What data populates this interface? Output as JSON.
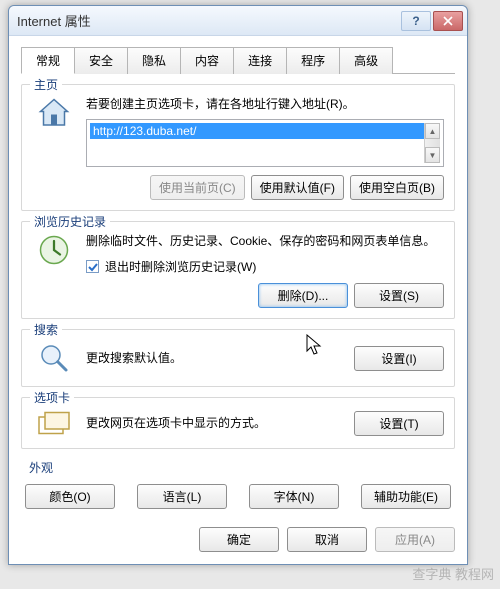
{
  "window": {
    "title": "Internet 属性"
  },
  "tabs": [
    "常规",
    "安全",
    "隐私",
    "内容",
    "连接",
    "程序",
    "高级"
  ],
  "active_tab": 0,
  "homepage": {
    "title": "主页",
    "instruction": "若要创建主页选项卡，请在各地址行键入地址(R)。",
    "url": "http://123.duba.net/",
    "buttons": {
      "current": "使用当前页(C)",
      "default": "使用默认值(F)",
      "blank": "使用空白页(B)"
    }
  },
  "history": {
    "title": "浏览历史记录",
    "desc": "删除临时文件、历史记录、Cookie、保存的密码和网页表单信息。",
    "checkbox_label": "退出时删除浏览历史记录(W)",
    "checked": true,
    "buttons": {
      "delete": "删除(D)...",
      "settings": "设置(S)"
    }
  },
  "search": {
    "title": "搜索",
    "desc": "更改搜索默认值。",
    "button": "设置(I)"
  },
  "tabs_section": {
    "title": "选项卡",
    "desc": "更改网页在选项卡中显示的方式。",
    "button": "设置(T)"
  },
  "appearance": {
    "title": "外观",
    "buttons": {
      "colors": "颜色(O)",
      "lang": "语言(L)",
      "fonts": "字体(N)",
      "access": "辅助功能(E)"
    }
  },
  "dialog": {
    "ok": "确定",
    "cancel": "取消",
    "apply": "应用(A)"
  },
  "watermark": "查字典 教程网"
}
